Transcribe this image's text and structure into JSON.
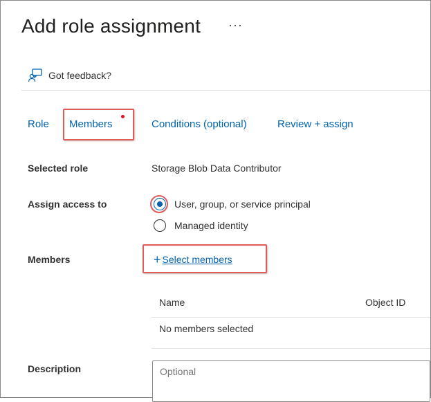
{
  "header": {
    "title": "Add role assignment",
    "more_label": "···"
  },
  "feedback": {
    "label": "Got feedback?"
  },
  "tabs": [
    {
      "label": "Role"
    },
    {
      "label": "Members"
    },
    {
      "label": "Conditions (optional)"
    },
    {
      "label": "Review + assign"
    }
  ],
  "form": {
    "selected_role": {
      "label": "Selected role",
      "value": "Storage Blob Data Contributor"
    },
    "assign_access": {
      "label": "Assign access to",
      "options": [
        {
          "label": "User, group, or service principal",
          "checked": true
        },
        {
          "label": "Managed identity",
          "checked": false
        }
      ]
    },
    "members": {
      "label": "Members",
      "select_label": "Select members",
      "table": {
        "columns": [
          "Name",
          "Object ID"
        ],
        "empty_text": "No members selected"
      }
    },
    "description": {
      "label": "Description",
      "placeholder": "Optional"
    }
  },
  "colors": {
    "link": "#0063b1",
    "highlight": "#e05a5a",
    "notification_dot": "#e81123"
  }
}
